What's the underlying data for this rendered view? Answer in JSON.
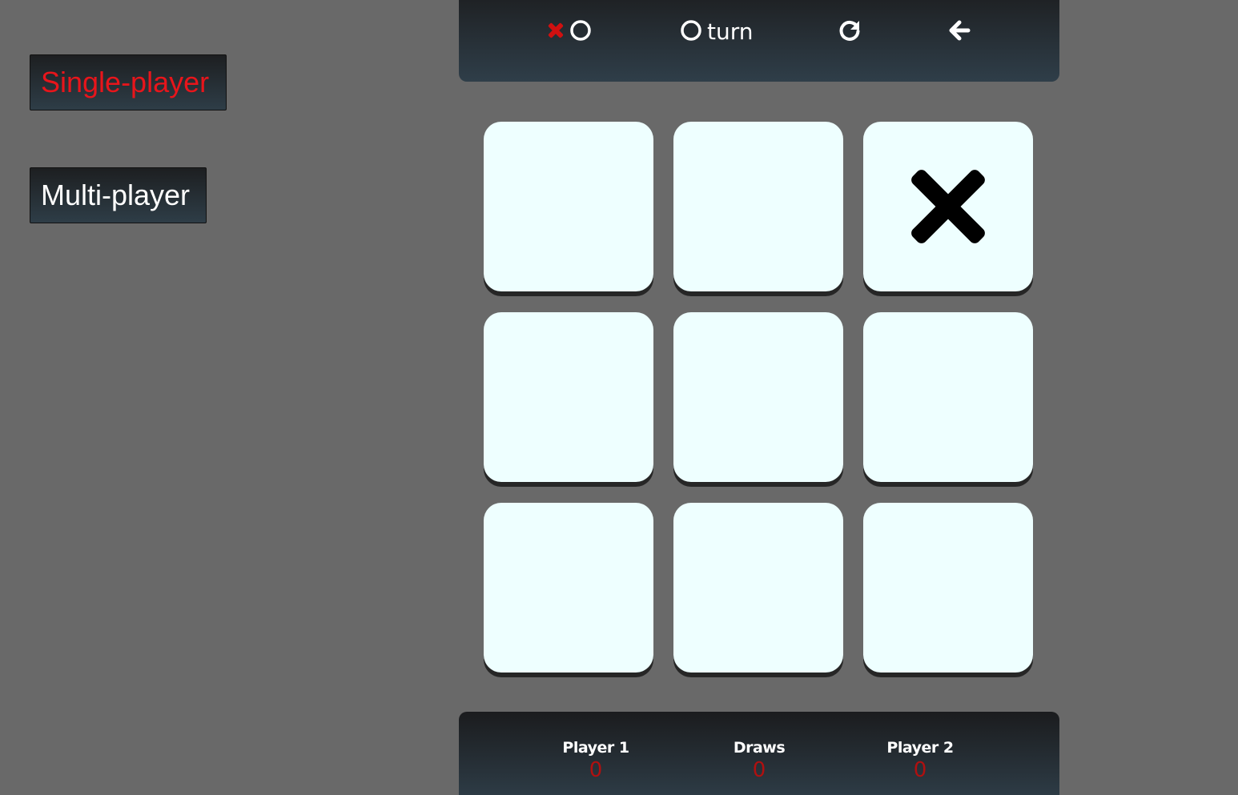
{
  "modes": {
    "single_label": "Single-player",
    "multi_label": "Multi-player",
    "selected": "single"
  },
  "topbar": {
    "symbol_x_icon": "x-icon",
    "symbol_o_icon": "o-icon",
    "turn_icon": "o-icon",
    "turn_label": "turn",
    "restart_icon": "restart-icon",
    "back_icon": "back-arrow-icon"
  },
  "board": {
    "cells": [
      "",
      "",
      "X",
      "",
      "",
      "",
      "",
      "",
      ""
    ]
  },
  "scores": {
    "player1_label": "Player 1",
    "player1_value": "0",
    "draws_label": "Draws",
    "draws_value": "0",
    "player2_label": "Player 2",
    "player2_value": "0"
  },
  "colors": {
    "background": "#696969",
    "accent_red": "#e8151b",
    "cell": "#eeffff",
    "score_red": "#b01010"
  }
}
